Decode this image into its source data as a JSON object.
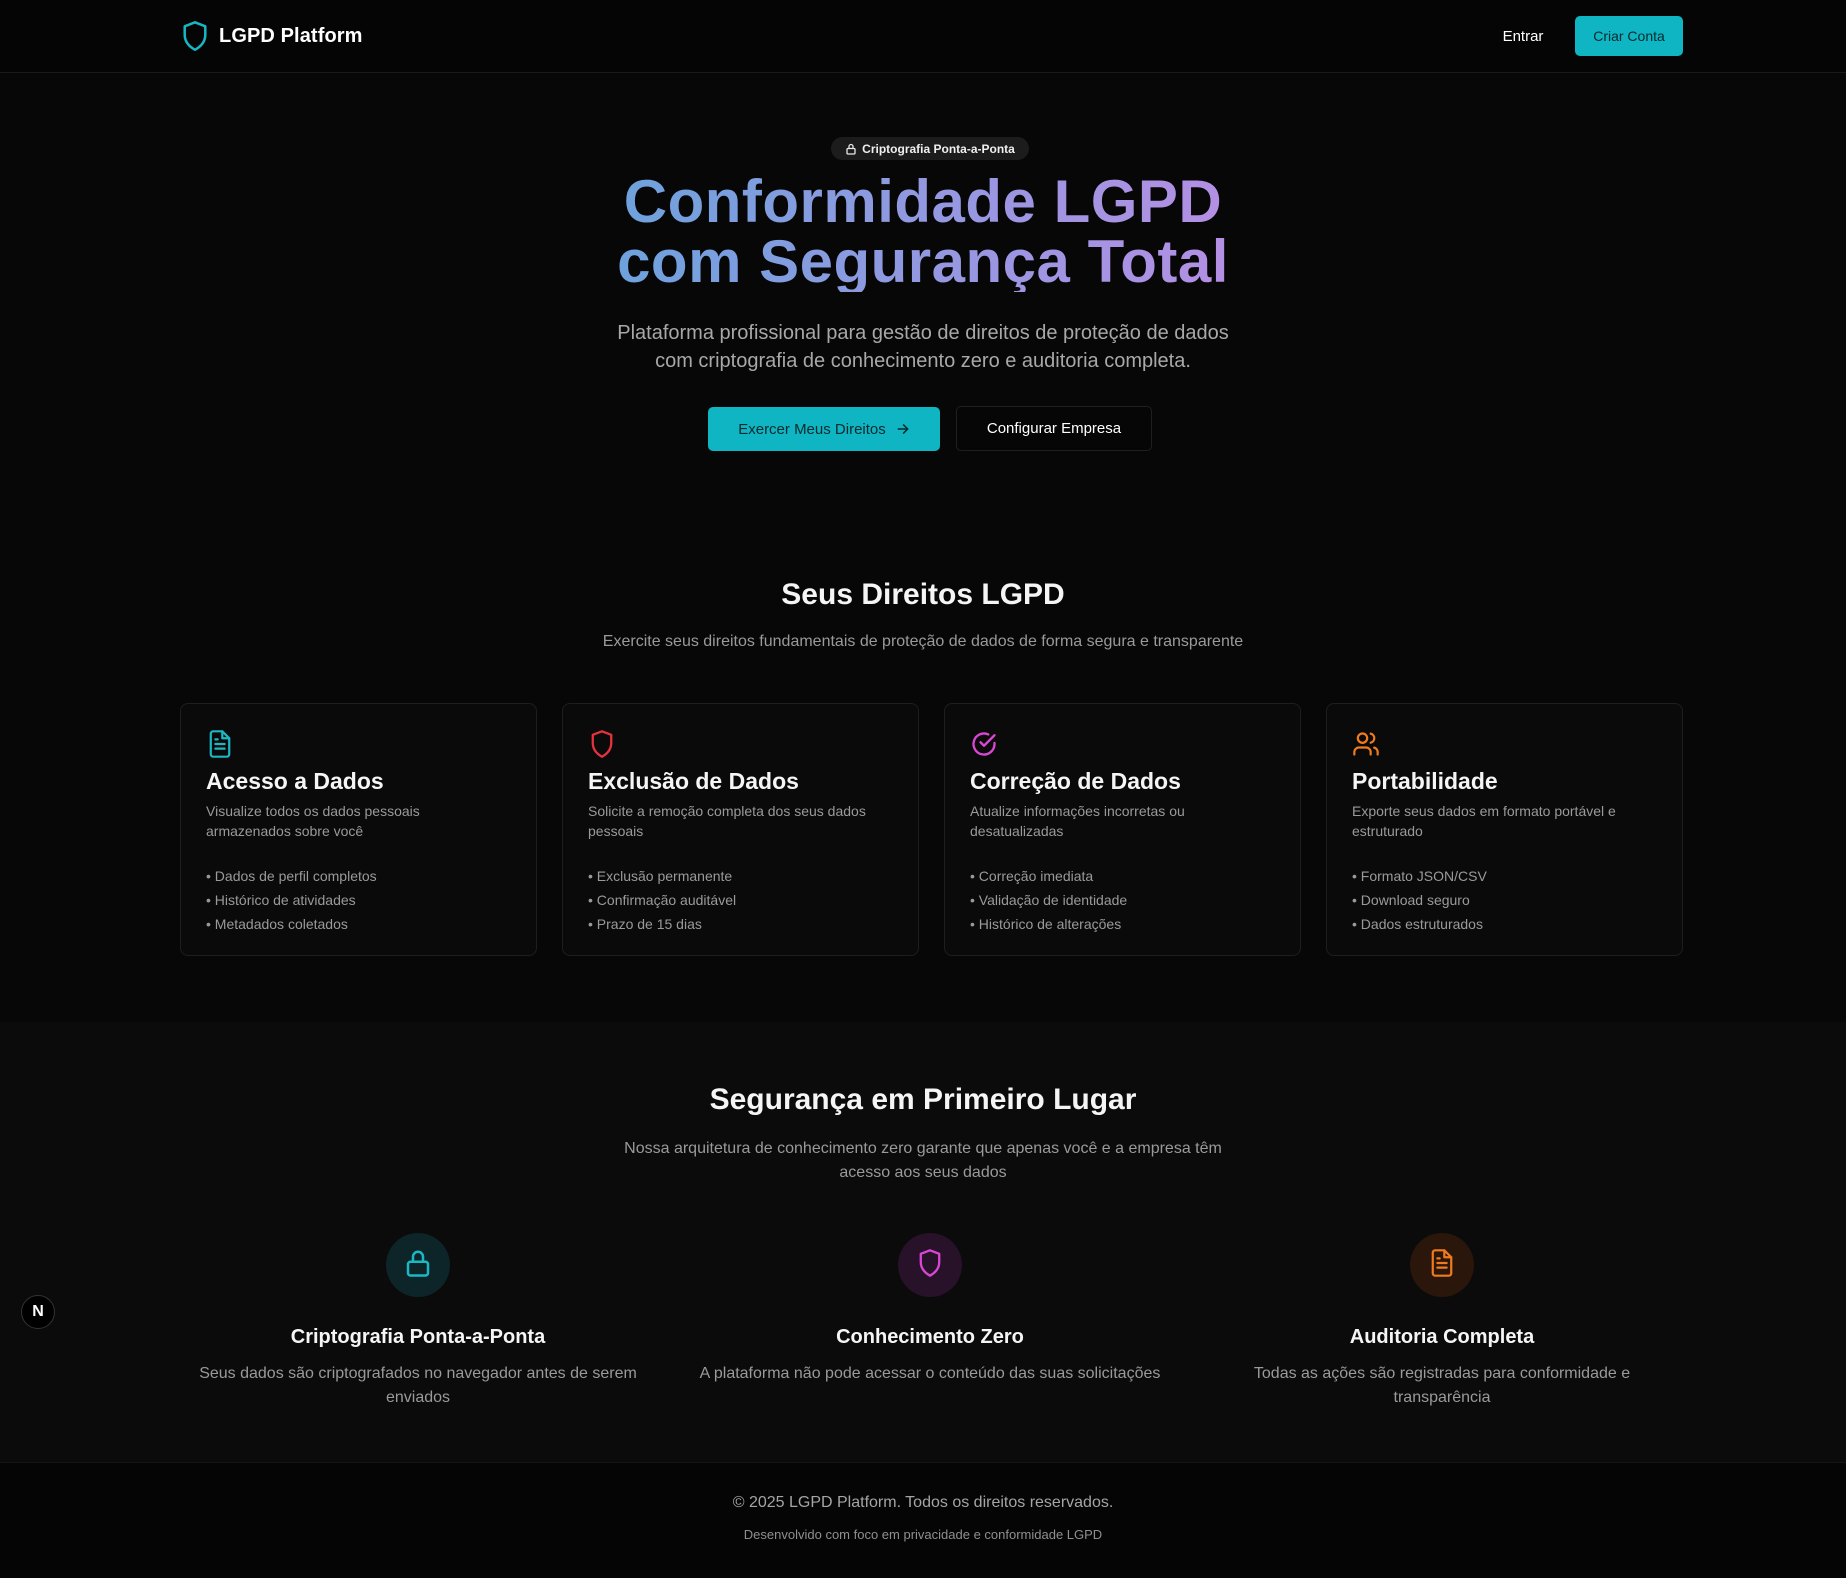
{
  "nav": {
    "brand": "LGPD Platform",
    "login_label": "Entrar",
    "signup_label": "Criar Conta"
  },
  "hero": {
    "badge": "Criptografia Ponta-a-Ponta",
    "title_line1": "Conformidade LGPD",
    "title_line2": "com Segurança Total",
    "subtitle_line1": "Plataforma profissional para gestão de direitos de proteção de dados",
    "subtitle_line2": "com criptografia de conhecimento zero e auditoria completa.",
    "primary_button": "Exercer Meus Direitos",
    "secondary_button": "Configurar Empresa"
  },
  "rights": {
    "title": "Seus Direitos LGPD",
    "subtitle": "Exercite seus direitos fundamentais de proteção de dados de forma segura e transparente",
    "cards": [
      {
        "icon": "document-icon",
        "color": "#1bb8c4",
        "title": "Acesso a Dados",
        "description": "Visualize todos os dados pessoais armazenados sobre você",
        "items": [
          "• Dados de perfil completos",
          "• Histórico de atividades",
          "• Metadados coletados"
        ]
      },
      {
        "icon": "shield-icon",
        "color": "#e5323c",
        "title": "Exclusão de Dados",
        "description": "Solicite a remoção completa dos seus dados pessoais",
        "items": [
          "• Exclusão permanente",
          "• Confirmação auditável",
          "• Prazo de 15 dias"
        ]
      },
      {
        "icon": "check-circle-icon",
        "color": "#d946d4",
        "title": "Correção de Dados",
        "description": "Atualize informações incorretas ou desatualizadas",
        "items": [
          "• Correção imediata",
          "• Validação de identidade",
          "• Histórico de alterações"
        ]
      },
      {
        "icon": "users-icon",
        "color": "#f07b1c",
        "title": "Portabilidade",
        "description": "Exporte seus dados em formato portável e estruturado",
        "items": [
          "• Formato JSON/CSV",
          "• Download seguro",
          "• Dados estruturados"
        ]
      }
    ]
  },
  "security": {
    "title": "Segurança em Primeiro Lugar",
    "subtitle": "Nossa arquitetura de conhecimento zero garante que apenas você e a empresa têm acesso aos seus dados",
    "features": [
      {
        "icon": "lock-icon",
        "color": "#1bb8c4",
        "bg": "#0d2528",
        "title": "Criptografia Ponta-a-Ponta",
        "description": "Seus dados são criptografados no navegador antes de serem enviados"
      },
      {
        "icon": "shield-icon",
        "color": "#d946d4",
        "bg": "#27122a",
        "title": "Conhecimento Zero",
        "description": "A plataforma não pode acessar o conteúdo das suas solicitações"
      },
      {
        "icon": "document-icon",
        "color": "#f07b1c",
        "bg": "#2a160b",
        "title": "Auditoria Completa",
        "description": "Todas as ações são registradas para conformidade e transparência"
      }
    ]
  },
  "footer": {
    "copyright": "© 2025 LGPD Platform. Todos os direitos reservados.",
    "note": "Desenvolvido com foco em privacidade e conformidade LGPD"
  },
  "dev_badge": "N"
}
